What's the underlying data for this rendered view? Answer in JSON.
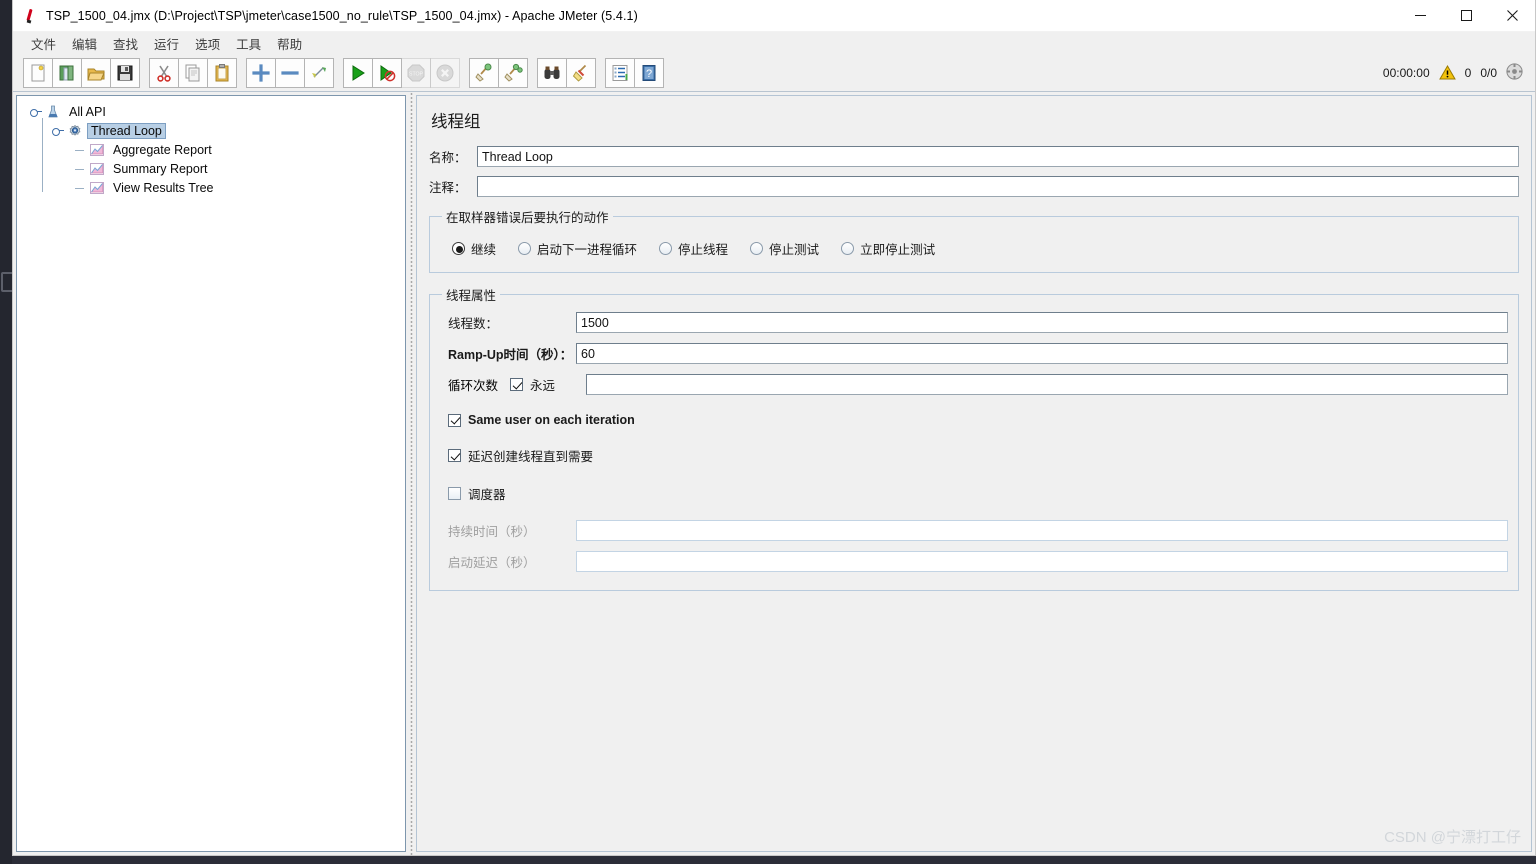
{
  "window": {
    "title": "TSP_1500_04.jmx (D:\\Project\\TSP\\jmeter\\case1500_no_rule\\TSP_1500_04.jmx) - Apache JMeter (5.4.1)",
    "icon": "jmeter-feather-icon",
    "controls": {
      "minimize": "—",
      "maximize": "☐",
      "close": "✕"
    }
  },
  "menubar": {
    "items": [
      {
        "label": "文件",
        "name": "menu-file"
      },
      {
        "label": "编辑",
        "name": "menu-edit"
      },
      {
        "label": "查找",
        "name": "menu-search"
      },
      {
        "label": "运行",
        "name": "menu-run"
      },
      {
        "label": "选项",
        "name": "menu-options"
      },
      {
        "label": "工具",
        "name": "menu-tools"
      },
      {
        "label": "帮助",
        "name": "menu-help"
      }
    ]
  },
  "toolbar": {
    "buttons": [
      {
        "name": "new-button",
        "icon": "new-document-icon",
        "disabled": false
      },
      {
        "name": "templates-button",
        "icon": "templates-icon",
        "disabled": false
      },
      {
        "name": "open-button",
        "icon": "open-folder-icon",
        "disabled": false
      },
      {
        "name": "save-button",
        "icon": "floppy-disk-icon",
        "disabled": false
      },
      {
        "name": "cut-button",
        "icon": "scissors-icon",
        "disabled": false
      },
      {
        "name": "copy-button",
        "icon": "copy-pages-icon",
        "disabled": false
      },
      {
        "name": "paste-button",
        "icon": "clipboard-icon",
        "disabled": false
      },
      {
        "name": "expand-all-button",
        "icon": "plus-icon",
        "disabled": false
      },
      {
        "name": "collapse-all-button",
        "icon": "minus-icon",
        "disabled": false
      },
      {
        "name": "toggle-button",
        "icon": "toggle-arrows-icon",
        "disabled": false
      },
      {
        "name": "start-button",
        "icon": "play-green-icon",
        "disabled": false
      },
      {
        "name": "start-no-pauses-button",
        "icon": "play-no-pauses-icon",
        "disabled": false
      },
      {
        "name": "stop-button",
        "icon": "stop-sign-icon",
        "disabled": true
      },
      {
        "name": "shutdown-button",
        "icon": "shutdown-x-icon",
        "disabled": true
      },
      {
        "name": "clear-button",
        "icon": "broom-green-icon",
        "disabled": false
      },
      {
        "name": "clear-all-button",
        "icon": "broom-all-icon",
        "disabled": false
      },
      {
        "name": "search-button",
        "icon": "binoculars-icon",
        "disabled": false
      },
      {
        "name": "reset-search-button",
        "icon": "broom-yellow-icon",
        "disabled": false
      },
      {
        "name": "function-helper-button",
        "icon": "function-list-icon",
        "disabled": false
      },
      {
        "name": "help-button",
        "icon": "help-book-icon",
        "disabled": false
      }
    ],
    "status": {
      "elapsed": "00:00:00",
      "warning_icon": "warning-triangle-icon",
      "warning_count": "0",
      "threads": "0/0",
      "settings_icon": "gear-circle-icon"
    }
  },
  "tree": {
    "nodes": [
      {
        "label": "All API",
        "icon": "jmeter-plan-icon",
        "indent": 1,
        "selected": false,
        "expanded": true
      },
      {
        "label": "Thread Loop",
        "icon": "thread-group-gear-icon",
        "indent": 2,
        "selected": true,
        "expanded": true
      },
      {
        "label": "Aggregate Report",
        "icon": "listener-chart-icon",
        "indent": 3,
        "selected": false,
        "expanded": false
      },
      {
        "label": "Summary Report",
        "icon": "listener-chart-icon",
        "indent": 3,
        "selected": false,
        "expanded": false
      },
      {
        "label": "View Results Tree",
        "icon": "listener-chart-icon",
        "indent": 3,
        "selected": false,
        "expanded": false
      }
    ]
  },
  "main": {
    "panel_title": "线程组",
    "name_label": "名称：",
    "name_value": "Thread Loop",
    "comment_label": "注释：",
    "comment_value": "",
    "error_action": {
      "legend": "在取样器错误后要执行的动作",
      "options": [
        {
          "label": "继续",
          "checked": true,
          "name": "radio-continue"
        },
        {
          "label": "启动下一进程循环",
          "checked": false,
          "name": "radio-start-next-loop"
        },
        {
          "label": "停止线程",
          "checked": false,
          "name": "radio-stop-thread"
        },
        {
          "label": "停止测试",
          "checked": false,
          "name": "radio-stop-test"
        },
        {
          "label": "立即停止测试",
          "checked": false,
          "name": "radio-stop-test-now"
        }
      ]
    },
    "thread_props": {
      "legend": "线程属性",
      "num_threads_label": "线程数：",
      "num_threads_value": "1500",
      "ramp_up_label": "Ramp-Up时间（秒）：",
      "ramp_up_value": "60",
      "loop_count_label": "循环次数",
      "loop_forever_label": "永远",
      "loop_forever_checked": true,
      "loop_count_value": "",
      "same_user_label": "Same user on each iteration",
      "same_user_checked": true,
      "delayed_start_label": "延迟创建线程直到需要",
      "delayed_start_checked": true,
      "scheduler_label": "调度器",
      "scheduler_checked": false,
      "duration_label": "持续时间（秒）",
      "duration_value": "",
      "startup_delay_label": "启动延迟（秒）",
      "startup_delay_value": ""
    }
  },
  "watermark": "CSDN @宁漂打工仔",
  "colors": {
    "accent": "#b8cfe5",
    "group_border": "#b9cbdd",
    "play_green": "#1a9b1a",
    "warning_yellow": "#f2c20c",
    "window_bg": "#f0f0f0"
  }
}
